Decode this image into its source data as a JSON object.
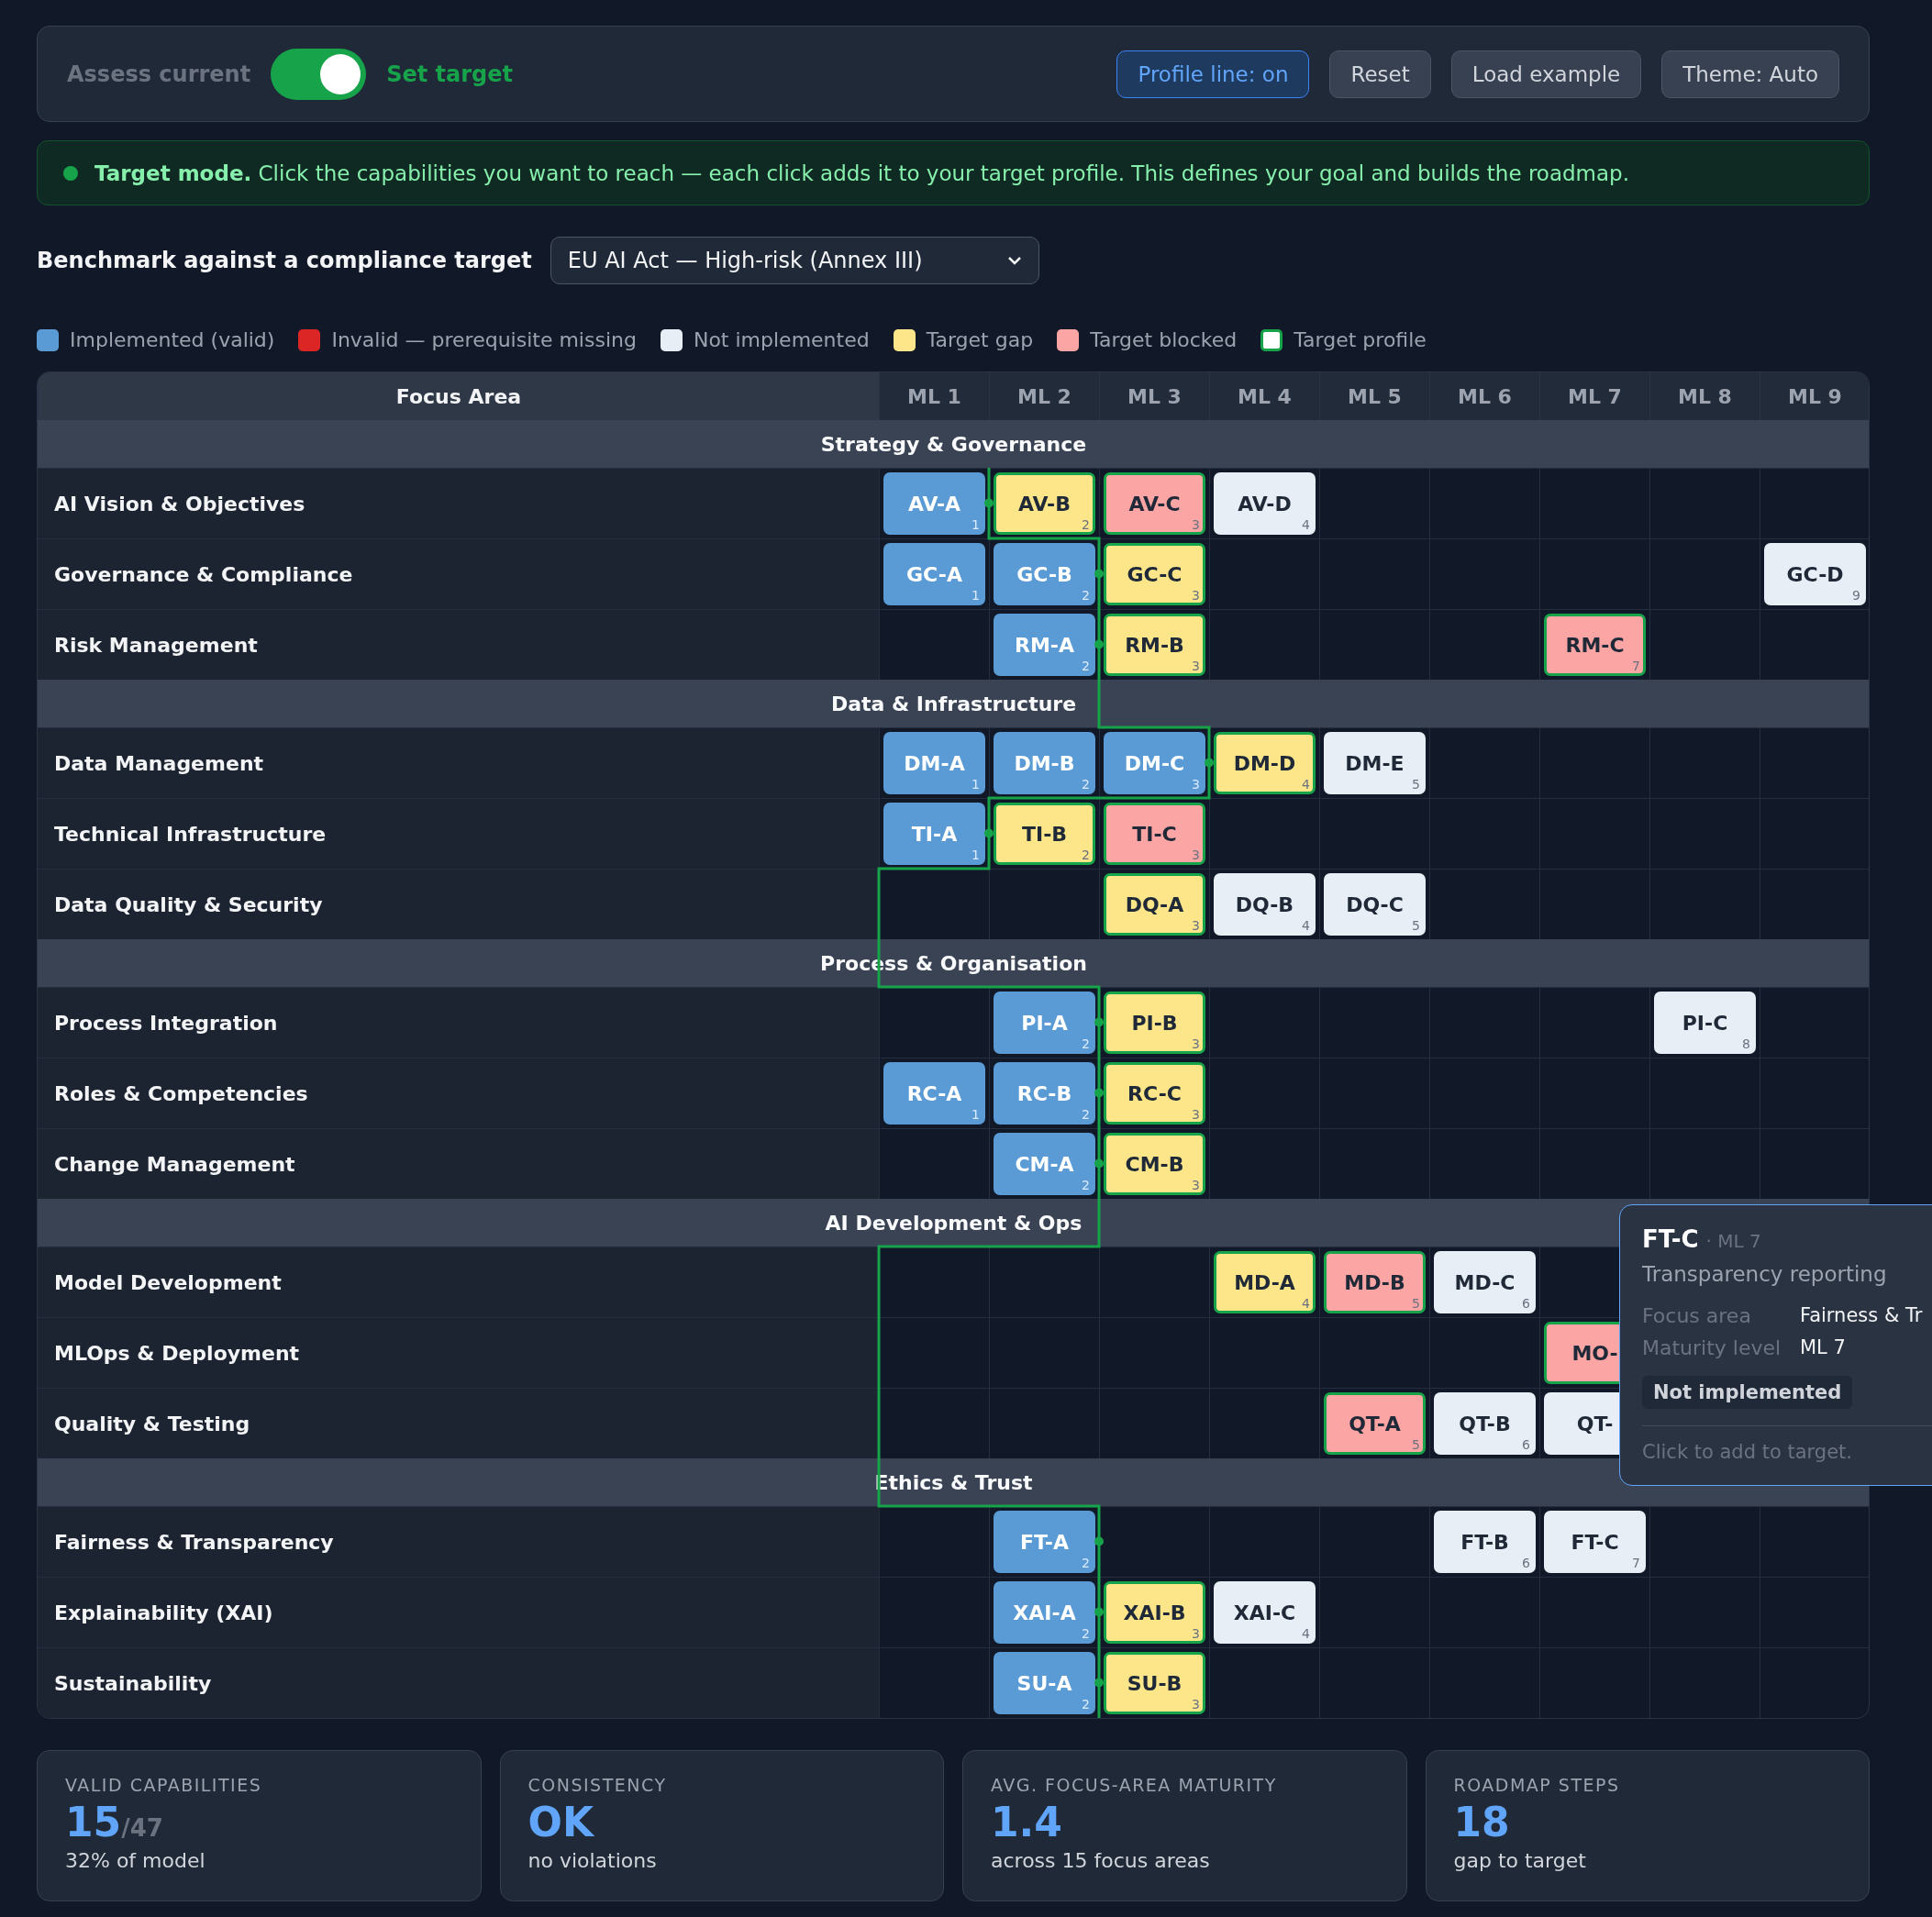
{
  "toolbar": {
    "mode_switch": {
      "left_label": "Assess current",
      "right_label": "Set target",
      "on": true
    },
    "buttons": [
      {
        "label": "Profile line: on",
        "selected": true
      },
      {
        "label": "Reset",
        "selected": false
      },
      {
        "label": "Load example",
        "selected": false
      },
      {
        "label": "Theme: Auto",
        "selected": false
      }
    ]
  },
  "banner": {
    "text": "**Target mode.** Click the capabilities you want to reach — each click adds it to your target profile. This defines your goal and builds the roadmap."
  },
  "benchmark": {
    "label": "Benchmark against a compliance target",
    "value": "EU AI Act — High-risk (Annex III)"
  },
  "legend": [
    {
      "label": "Implemented (valid)",
      "color": "#5b9bd5",
      "kind": "fill"
    },
    {
      "label": "Invalid — prerequisite missing",
      "color": "#dc2626",
      "kind": "fill"
    },
    {
      "label": "Not implemented",
      "color": "#e8eef6",
      "kind": "fill"
    },
    {
      "label": "Target gap",
      "color": "#fde68a",
      "kind": "fill"
    },
    {
      "label": "Target blocked",
      "color": "#fca5a5",
      "kind": "fill"
    },
    {
      "label": "Target profile",
      "color": "#16a34a",
      "kind": "outline"
    }
  ],
  "table": {
    "columns": [
      "Focus Area",
      "ML 1",
      "ML 2",
      "ML 3",
      "ML 4",
      "ML 5",
      "ML 6",
      "ML 7",
      "ML 8",
      "ML 9"
    ],
    "groups": [
      {
        "title": "Strategy & Governance",
        "rows": [
          {
            "name": "AI Vision & Objectives",
            "cells": [
              {
                "code": "AV-A",
                "ml": "1",
                "color": "#5b9bd5",
                "target": false
              },
              {
                "code": "AV-B",
                "ml": "2",
                "color": "#fde68a",
                "target": true
              },
              {
                "code": "AV-C",
                "ml": "3",
                "color": "#fca5a5",
                "target": true
              },
              {
                "code": "AV-D",
                "ml": "4",
                "color": "#e8eef6",
                "target": false
              },
              null,
              null,
              null,
              null,
              null
            ]
          },
          {
            "name": "Governance & Compliance",
            "cells": [
              {
                "code": "GC-A",
                "ml": "1",
                "color": "#5b9bd5",
                "target": false
              },
              {
                "code": "GC-B",
                "ml": "2",
                "color": "#5b9bd5",
                "target": false
              },
              {
                "code": "GC-C",
                "ml": "3",
                "color": "#fde68a",
                "target": true
              },
              null,
              null,
              null,
              null,
              null,
              {
                "code": "GC-D",
                "ml": "9",
                "color": "#e8eef6",
                "target": false
              }
            ]
          },
          {
            "name": "Risk Management",
            "cells": [
              null,
              {
                "code": "RM-A",
                "ml": "2",
                "color": "#5b9bd5",
                "target": false
              },
              {
                "code": "RM-B",
                "ml": "3",
                "color": "#fde68a",
                "target": true
              },
              null,
              null,
              null,
              {
                "code": "RM-C",
                "ml": "7",
                "color": "#fca5a5",
                "target": true
              },
              null,
              null
            ]
          }
        ]
      },
      {
        "title": "Data & Infrastructure",
        "rows": [
          {
            "name": "Data Management",
            "cells": [
              {
                "code": "DM-A",
                "ml": "1",
                "color": "#5b9bd5",
                "target": false
              },
              {
                "code": "DM-B",
                "ml": "2",
                "color": "#5b9bd5",
                "target": false
              },
              {
                "code": "DM-C",
                "ml": "3",
                "color": "#5b9bd5",
                "target": false
              },
              {
                "code": "DM-D",
                "ml": "4",
                "color": "#fde68a",
                "target": true
              },
              {
                "code": "DM-E",
                "ml": "5",
                "color": "#e8eef6",
                "target": false
              },
              null,
              null,
              null,
              null
            ]
          },
          {
            "name": "Technical Infrastructure",
            "cells": [
              {
                "code": "TI-A",
                "ml": "1",
                "color": "#5b9bd5",
                "target": false
              },
              {
                "code": "TI-B",
                "ml": "2",
                "color": "#fde68a",
                "target": true
              },
              {
                "code": "TI-C",
                "ml": "3",
                "color": "#fca5a5",
                "target": true
              },
              null,
              null,
              null,
              null,
              null,
              null
            ]
          },
          {
            "name": "Data Quality & Security",
            "cells": [
              null,
              null,
              {
                "code": "DQ-A",
                "ml": "3",
                "color": "#fde68a",
                "target": true
              },
              {
                "code": "DQ-B",
                "ml": "4",
                "color": "#e8eef6",
                "target": false
              },
              {
                "code": "DQ-C",
                "ml": "5",
                "color": "#e8eef6",
                "target": false
              },
              null,
              null,
              null,
              null
            ]
          }
        ]
      },
      {
        "title": "Process & Organisation",
        "rows": [
          {
            "name": "Process Integration",
            "cells": [
              null,
              {
                "code": "PI-A",
                "ml": "2",
                "color": "#5b9bd5",
                "target": false
              },
              {
                "code": "PI-B",
                "ml": "3",
                "color": "#fde68a",
                "target": true
              },
              null,
              null,
              null,
              null,
              {
                "code": "PI-C",
                "ml": "8",
                "color": "#e8eef6",
                "target": false
              },
              null
            ]
          },
          {
            "name": "Roles & Competencies",
            "cells": [
              {
                "code": "RC-A",
                "ml": "1",
                "color": "#5b9bd5",
                "target": false
              },
              {
                "code": "RC-B",
                "ml": "2",
                "color": "#5b9bd5",
                "target": false
              },
              {
                "code": "RC-C",
                "ml": "3",
                "color": "#fde68a",
                "target": true
              },
              null,
              null,
              null,
              null,
              null,
              null
            ]
          },
          {
            "name": "Change Management",
            "cells": [
              null,
              {
                "code": "CM-A",
                "ml": "2",
                "color": "#5b9bd5",
                "target": false
              },
              {
                "code": "CM-B",
                "ml": "3",
                "color": "#fde68a",
                "target": true
              },
              null,
              null,
              null,
              null,
              null,
              null
            ]
          }
        ]
      },
      {
        "title": "AI Development & Ops",
        "rows": [
          {
            "name": "Model Development",
            "cells": [
              null,
              null,
              null,
              {
                "code": "MD-A",
                "ml": "4",
                "color": "#fde68a",
                "target": true
              },
              {
                "code": "MD-B",
                "ml": "5",
                "color": "#fca5a5",
                "target": true
              },
              {
                "code": "MD-C",
                "ml": "6",
                "color": "#e8eef6",
                "target": false
              },
              null,
              null,
              null
            ]
          },
          {
            "name": "MLOps & Deployment",
            "cells": [
              null,
              null,
              null,
              null,
              null,
              null,
              {
                "code": "MO-",
                "color": "#fca5a5",
                "target": true
              },
              null,
              null
            ]
          },
          {
            "name": "Quality & Testing",
            "cells": [
              null,
              null,
              null,
              null,
              {
                "code": "QT-A",
                "ml": "5",
                "color": "#fca5a5",
                "target": true
              },
              {
                "code": "QT-B",
                "ml": "6",
                "color": "#e8eef6",
                "target": false
              },
              {
                "code": "QT-",
                "color": "#e8eef6",
                "target": false
              },
              null,
              null
            ]
          }
        ]
      },
      {
        "title": "Ethics & Trust",
        "rows": [
          {
            "name": "Fairness & Transparency",
            "cells": [
              null,
              {
                "code": "FT-A",
                "ml": "2",
                "color": "#5b9bd5",
                "target": false
              },
              null,
              null,
              null,
              {
                "code": "FT-B",
                "ml": "6",
                "color": "#e8eef6",
                "target": false
              },
              {
                "code": "FT-C",
                "ml": "7",
                "color": "#e8eef6",
                "target": false
              },
              null,
              null
            ]
          },
          {
            "name": "Explainability (XAI)",
            "cells": [
              null,
              {
                "code": "XAI-A",
                "ml": "2",
                "color": "#5b9bd5",
                "target": false
              },
              {
                "code": "XAI-B",
                "ml": "3",
                "color": "#fde68a",
                "target": true
              },
              {
                "code": "XAI-C",
                "ml": "4",
                "color": "#e8eef6",
                "target": false
              },
              null,
              null,
              null,
              null,
              null
            ]
          },
          {
            "name": "Sustainability",
            "cells": [
              null,
              {
                "code": "SU-A",
                "ml": "2",
                "color": "#5b9bd5",
                "target": false
              },
              {
                "code": "SU-B",
                "ml": "3",
                "color": "#fde68a",
                "target": true
              },
              null,
              null,
              null,
              null,
              null,
              null
            ]
          }
        ]
      }
    ]
  },
  "tooltip": {
    "code": "FT-C",
    "subtitle": "· ML 7",
    "description": "Transparency reporting",
    "fields": [
      {
        "label": "Focus area",
        "value": "Fairness & Tr"
      },
      {
        "label": "Maturity level",
        "value": "ML 7"
      }
    ],
    "status": "Not implemented",
    "hint": "Click to add to target."
  },
  "stats": [
    {
      "label": "VALID CAPABILITIES",
      "value": "15",
      "suffix": "/47",
      "caption": "32% of model"
    },
    {
      "label": "CONSISTENCY",
      "value": "OK",
      "caption": "no violations"
    },
    {
      "label": "AVG. FOCUS-AREA MATURITY",
      "value": "1.4",
      "caption": "across 15 focus areas"
    },
    {
      "label": "ROADMAP STEPS",
      "value": "18",
      "caption": "gap to target"
    }
  ]
}
